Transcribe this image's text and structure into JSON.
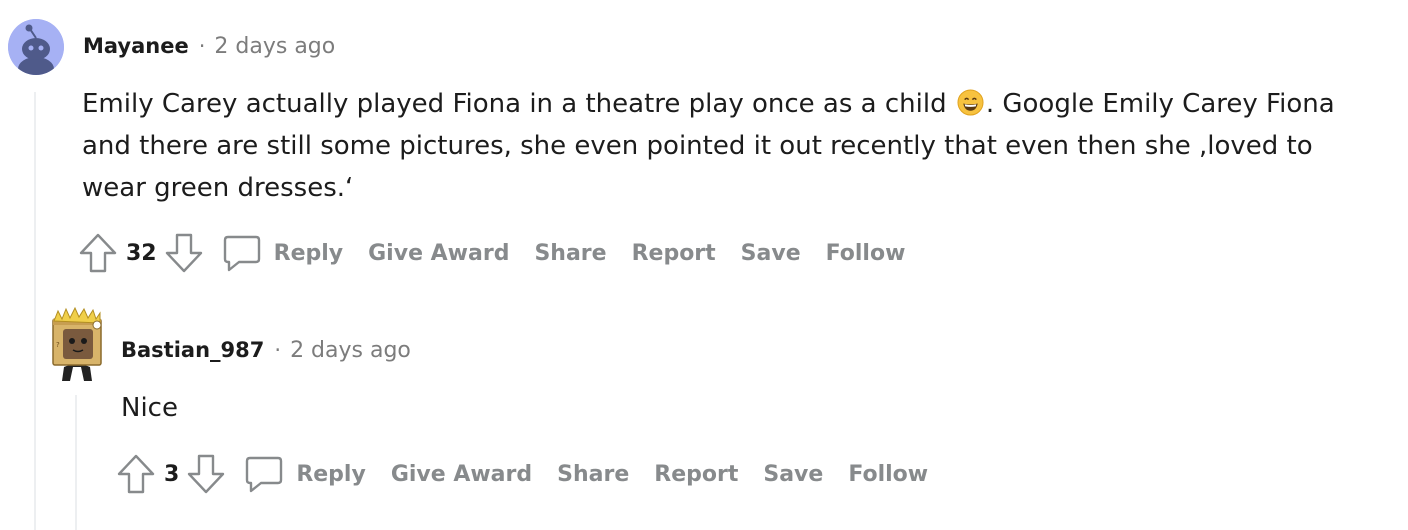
{
  "comments": [
    {
      "username": "Mayanee",
      "separator": "·",
      "time": "2 days ago",
      "body": {
        "part1": "Emily Carey actually played Fiona in a theatre play once as a child ",
        "emoji": "grinning-face-emoji",
        "part2": ". Google Emily Carey Fiona and there are still some pictures, she even pointed it out recently that even then she ,loved to wear green dresses.‘"
      },
      "score": "32",
      "actions": {
        "reply": "Reply",
        "give_award": "Give Award",
        "share": "Share",
        "report": "Report",
        "save": "Save",
        "follow": "Follow"
      }
    },
    {
      "username": "Bastian_987",
      "separator": "·",
      "time": "2 days ago",
      "body": "Nice",
      "score": "3",
      "actions": {
        "reply": "Reply",
        "give_award": "Give Award",
        "share": "Share",
        "report": "Report",
        "save": "Save",
        "follow": "Follow"
      }
    }
  ],
  "colors": {
    "thread_line": "#edeff1",
    "muted": "#878a8c",
    "avatar_bg": "#a6b1f4"
  },
  "icons": [
    "snoo-avatar",
    "upvote-icon",
    "downvote-icon",
    "comment-icon"
  ]
}
